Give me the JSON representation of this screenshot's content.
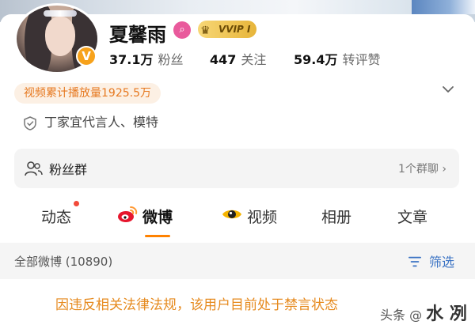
{
  "profile": {
    "name": "夏馨雨",
    "verified_mark": "V",
    "vip_label": "VVIP I",
    "stats": [
      {
        "num": "37.1万",
        "label": "粉丝"
      },
      {
        "num": "447",
        "label": "关注"
      },
      {
        "num": "59.4万",
        "label": "转评赞"
      }
    ],
    "views_pill": "视频累计播放量1925.5万",
    "endorsement": "丁家宜代言人、模特"
  },
  "fans_group": {
    "label": "粉丝群",
    "count_text": "1个群聊 ›"
  },
  "tabs": [
    {
      "label": "动态",
      "active": false
    },
    {
      "label": "微博",
      "active": true
    },
    {
      "label": "视频",
      "active": false
    },
    {
      "label": "相册",
      "active": false
    },
    {
      "label": "文章",
      "active": false
    }
  ],
  "feed": {
    "all_label": "全部微博 (10890)",
    "filter_label": "筛选"
  },
  "notice": "因违反相关法律法规，该用户目前处于禁言状态",
  "watermark": {
    "prefix": "头条",
    "mark": "@",
    "text": "水 冽"
  },
  "colors": {
    "accent": "#ff8200",
    "notice": "#e68a1e",
    "link": "#3b73c4",
    "pill_bg": "#fcf0e4"
  }
}
